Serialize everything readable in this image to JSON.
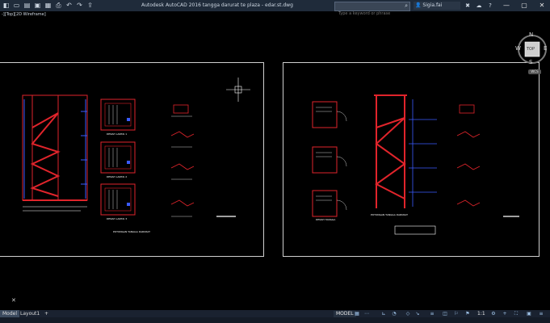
{
  "app": {
    "title": "Autodesk AutoCAD 2016    tangga darurat te plaza - edar.st.dwg",
    "search_placeholder": "Type a keyword or phrase",
    "user": "Sigia.fai",
    "viewport_label": "-][Top][2D Wireframe]"
  },
  "viewcube": {
    "north": "N",
    "west": "W",
    "east": "E",
    "south": "S",
    "face": "TOP",
    "wcs": "WCS"
  },
  "tabs": [
    {
      "label": "Model"
    },
    {
      "label": "Layout1"
    },
    {
      "label": "+"
    }
  ],
  "status": {
    "model": "MODEL",
    "scale": "1:1"
  },
  "drawing_labels": {
    "left_sheet_caption": "POTONGAN TANGGA DARURAT",
    "left_plan_a": "DENAH LANTAI 1",
    "left_plan_b": "DENAH LANTAI 2",
    "left_plan_c": "DENAH LANTAI 3",
    "right_sheet_caption": "POTONGAN TANGGA DARURAT",
    "right_plan_caption": "DENAH TANGGA"
  },
  "colors": {
    "accent": "#e0242b",
    "steel": "#3a5bff",
    "paper_border": "#d0d0d0"
  }
}
